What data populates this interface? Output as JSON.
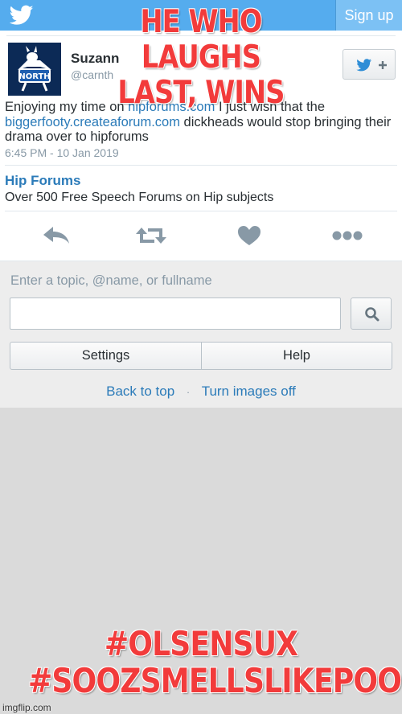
{
  "header": {
    "logo_icon": "twitter-bird-icon",
    "signup_label": "Sign up",
    "bg_color": "#55acee"
  },
  "tweet": {
    "display_name": "Suzann",
    "screen_name": "@carnth",
    "avatar_label": "NORTH",
    "follow_icon": "twitter-follow-plus-icon",
    "text_part1": "Enjoying my time on ",
    "link1": "hipforums.com",
    "text_part2": " I just wish that the ",
    "link2": "biggerfooty.createaforum.com",
    "text_part3": " dickheads would stop bringing their drama over to hipforums",
    "timestamp": "6:45 PM - 10 Jan 2019",
    "card_title": "Hip Forums",
    "card_description": "Over 500 Free Speech Forums on Hip subjects",
    "actions": [
      "reply-icon",
      "retweet-icon",
      "like-icon",
      "more-icon"
    ]
  },
  "search": {
    "label": "Enter a topic, @name, or fullname",
    "value": "",
    "button_icon": "search-icon"
  },
  "buttons": {
    "settings": "Settings",
    "help": "Help"
  },
  "footer": {
    "back_to_top": "Back to top",
    "separator": "·",
    "turn_images_off": "Turn images off"
  },
  "meme": {
    "top_text_line1": "HE WHO LAUGHS",
    "top_text_line2": "LAST, WINS",
    "bottom_text_line1": "#OLSENSUX",
    "bottom_text_line2": "#SOOZSMELLSLIKEPOO",
    "color": "#f23b3b"
  },
  "watermark": "imgflip.com"
}
